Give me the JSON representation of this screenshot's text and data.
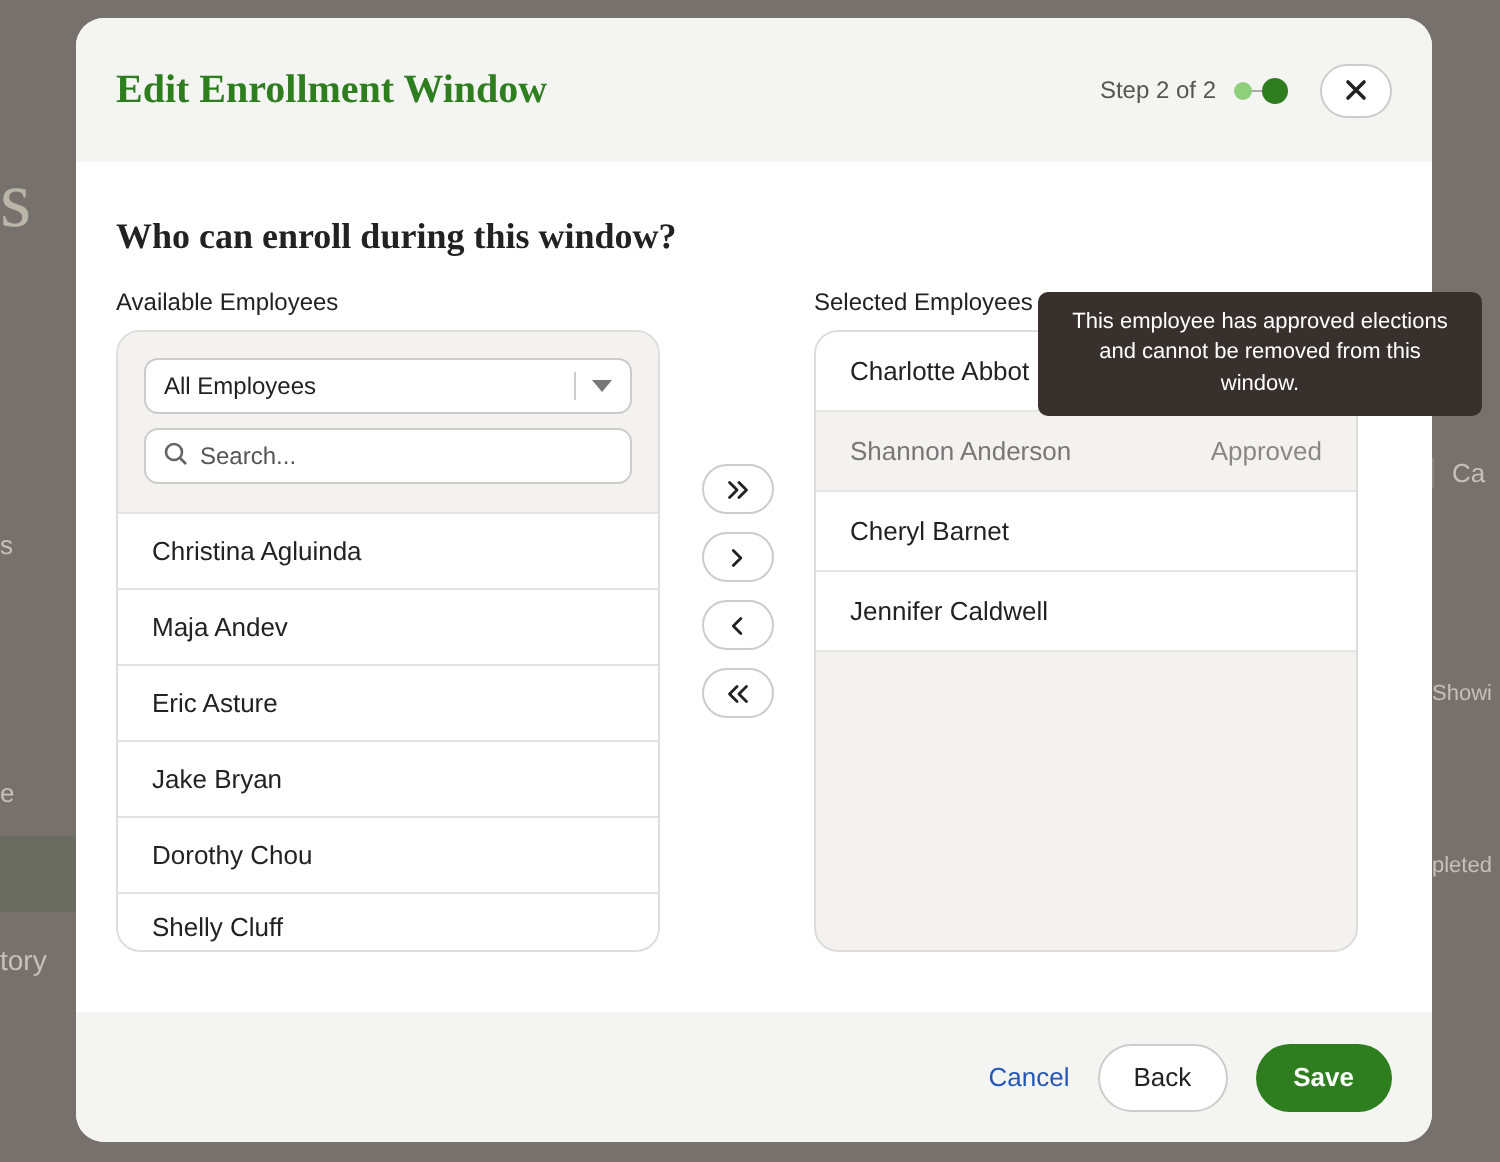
{
  "background": {
    "left_fragments": [
      {
        "text": "s",
        "kind": "heading"
      },
      {
        "text": "s",
        "kind": "item"
      },
      {
        "text": "e",
        "kind": "item"
      },
      {
        "text": "tory",
        "kind": "item"
      }
    ],
    "right_fragments": [
      {
        "text": "Ca"
      },
      {
        "text": "Showi"
      },
      {
        "text": "pleted"
      }
    ]
  },
  "dialog": {
    "title": "Edit Enrollment Window",
    "step_text": "Step 2 of 2",
    "steps": [
      {
        "current": false
      },
      {
        "current": true
      }
    ],
    "heading": "Who can enroll during this window?",
    "available": {
      "label": "Available Employees",
      "filter": "All Employees",
      "search_placeholder": "Search...",
      "items": [
        {
          "name": "Christina Agluinda"
        },
        {
          "name": "Maja Andev"
        },
        {
          "name": "Eric Asture"
        },
        {
          "name": "Jake Bryan"
        },
        {
          "name": "Dorothy Chou"
        },
        {
          "name": "Shelly Cluff"
        }
      ]
    },
    "move_buttons": [
      {
        "kind": "all-right"
      },
      {
        "kind": "right"
      },
      {
        "kind": "left"
      },
      {
        "kind": "all-left"
      }
    ],
    "selected": {
      "label": "Selected Employees",
      "items": [
        {
          "name": "Charlotte Abbot",
          "disabled": false
        },
        {
          "name": "Shannon Anderson",
          "disabled": true,
          "tag": "Approved"
        },
        {
          "name": "Cheryl Barnet",
          "disabled": false
        },
        {
          "name": "Jennifer Caldwell",
          "disabled": false
        }
      ]
    },
    "tooltip": "This employee has approved elections and cannot be removed from this window.",
    "buttons": [
      {
        "label": "Cancel",
        "kind": "link"
      },
      {
        "label": "Back",
        "kind": "secondary"
      },
      {
        "label": "Save",
        "kind": "primary"
      }
    ]
  }
}
